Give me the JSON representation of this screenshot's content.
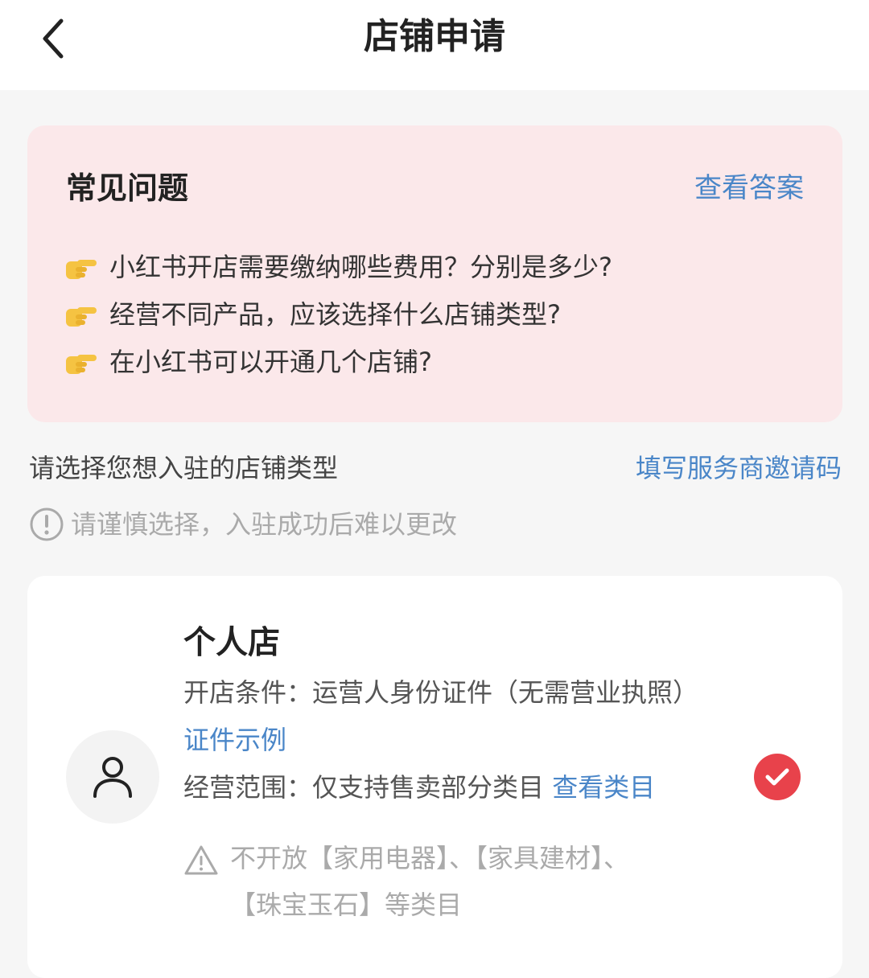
{
  "header": {
    "title": "店铺申请",
    "back_icon": "chevron-left-icon"
  },
  "faq": {
    "title": "常见问题",
    "link": "查看答案",
    "bullet_icon": "pointing-hand-icon",
    "items": [
      "小红书开店需要缴纳哪些费用？分别是多少?",
      "经营不同产品，应该选择什么店铺类型?",
      "在小红书可以开通几个店铺?"
    ]
  },
  "selection": {
    "label": "请选择您想入驻的店铺类型",
    "invite_link": "填写服务商邀请码",
    "warning": "请谨慎选择，入驻成功后难以更改"
  },
  "shop_option": {
    "name": "个人店",
    "condition_text": "开店条件：运营人身份证件（无需营业执照）",
    "condition_link": "证件示例",
    "scope_text": "经营范围：仅支持售卖部分类目",
    "scope_link": "查看类目",
    "notice": "不开放【家用电器】、【家具建材】、【珠宝玉石】等类目",
    "selected": true
  },
  "colors": {
    "accent_link": "#4a86c8",
    "faq_bg": "#fbe8ea",
    "check_red": "#e8424b",
    "page_bg": "#f6f6f6"
  }
}
